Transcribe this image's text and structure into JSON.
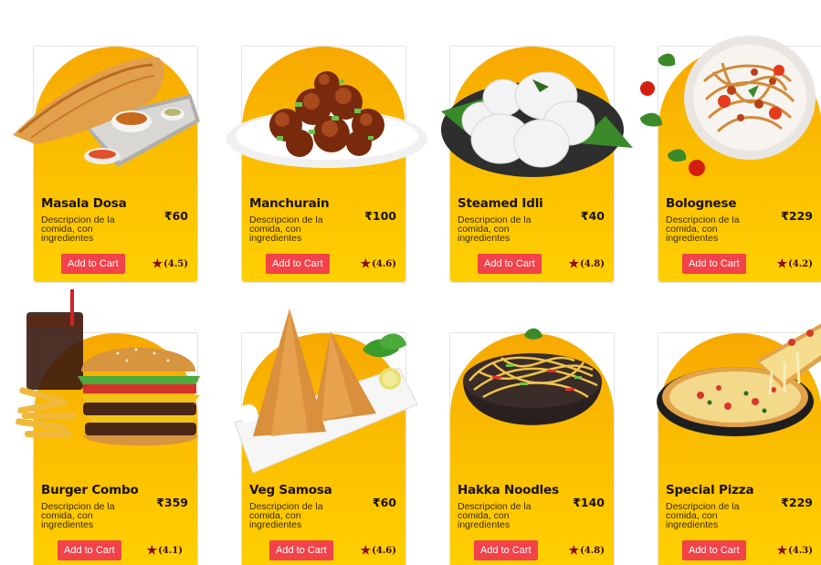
{
  "cards": [
    {
      "name": "Masala Dosa",
      "price": "₹60",
      "description": "Descripcion de la comida, con ingredientes",
      "button": "Add to Cart",
      "rating": "(4.5)",
      "icon": "masala-dosa-image"
    },
    {
      "name": "Manchurain",
      "price": "₹100",
      "description": "Descripcion de la comida, con ingredientes",
      "button": "Add to Cart",
      "rating": "(4.6)",
      "icon": "manchurian-image"
    },
    {
      "name": "Steamed Idli",
      "price": "₹40",
      "description": "Descripcion de la comida, con ingredientes",
      "button": "Add to Cart",
      "rating": "(4.8)",
      "icon": "idli-image"
    },
    {
      "name": "Bolognese",
      "price": "₹229",
      "description": "Descripcion de la comida, con ingredientes",
      "button": "Add to Cart",
      "rating": "(4.2)",
      "icon": "bolognese-image"
    },
    {
      "name": "Burger Combo",
      "price": "₹359",
      "description": "Descripcion de la comida, con ingredientes",
      "button": "Add to Cart",
      "rating": "(4.1)",
      "icon": "burger-combo-image"
    },
    {
      "name": "Veg Samosa",
      "price": "₹60",
      "description": "Descripcion de la comida, con ingredientes",
      "button": "Add to Cart",
      "rating": "(4.6)",
      "icon": "samosa-image"
    },
    {
      "name": "Hakka Noodles",
      "price": "₹140",
      "description": "Descripcion de la comida, con ingredientes",
      "button": "Add to Cart",
      "rating": "(4.8)",
      "icon": "noodles-image"
    },
    {
      "name": "Special Pizza",
      "price": "₹229",
      "description": "Descripcion de la comida, con ingredientes",
      "button": "Add to Cart",
      "rating": "(4.3)",
      "icon": "pizza-image"
    }
  ],
  "colors": {
    "accent": "#f2424a",
    "card_gradient_top": "#f7a800",
    "card_gradient_bottom": "#ffd000",
    "star": "#8b0c0c"
  }
}
